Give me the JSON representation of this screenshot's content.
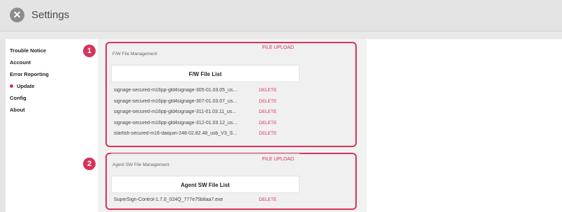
{
  "header": {
    "title": "Settings",
    "close_icon": "close-icon"
  },
  "sidebar": {
    "items": [
      {
        "label": "Trouble Notice"
      },
      {
        "label": "Account"
      },
      {
        "label": "Error Reporting"
      },
      {
        "label": "Update",
        "active": true
      },
      {
        "label": "Config"
      },
      {
        "label": "About"
      }
    ]
  },
  "fw": {
    "badge": "1",
    "section_title": "F/W File Management",
    "upload_label": "FILE UPLOAD",
    "list_title": "F/W File List",
    "files": [
      {
        "name": "signage-secured-m16pp-gld4signage-305-01.03.05_us...",
        "action": "DELETE"
      },
      {
        "name": "signage-secured-m16pp-gld4signage-307-01.03.07_us...",
        "action": "DELETE"
      },
      {
        "name": "signage-secured-m16pp-gld4signage-311-01.03.11_us...",
        "action": "DELETE"
      },
      {
        "name": "signage-secured-m16pp-gld4signage-312-01.03.12_us...",
        "action": "DELETE"
      },
      {
        "name": "starfish-secured-m16-daiquiri-248-02.82.48_usb_V3_S...",
        "action": "DELETE"
      }
    ]
  },
  "agent": {
    "badge": "2",
    "section_title": "Agent SW File Management",
    "upload_label": "FILE UPLOAD",
    "list_title": "Agent SW File List",
    "files": [
      {
        "name": "SuperSign-Control-1.7.0_024Q_777e75b8aa7.exe",
        "action": "DELETE"
      }
    ]
  },
  "colors": {
    "accent": "#d6335a",
    "background": "#e6e6e6"
  }
}
